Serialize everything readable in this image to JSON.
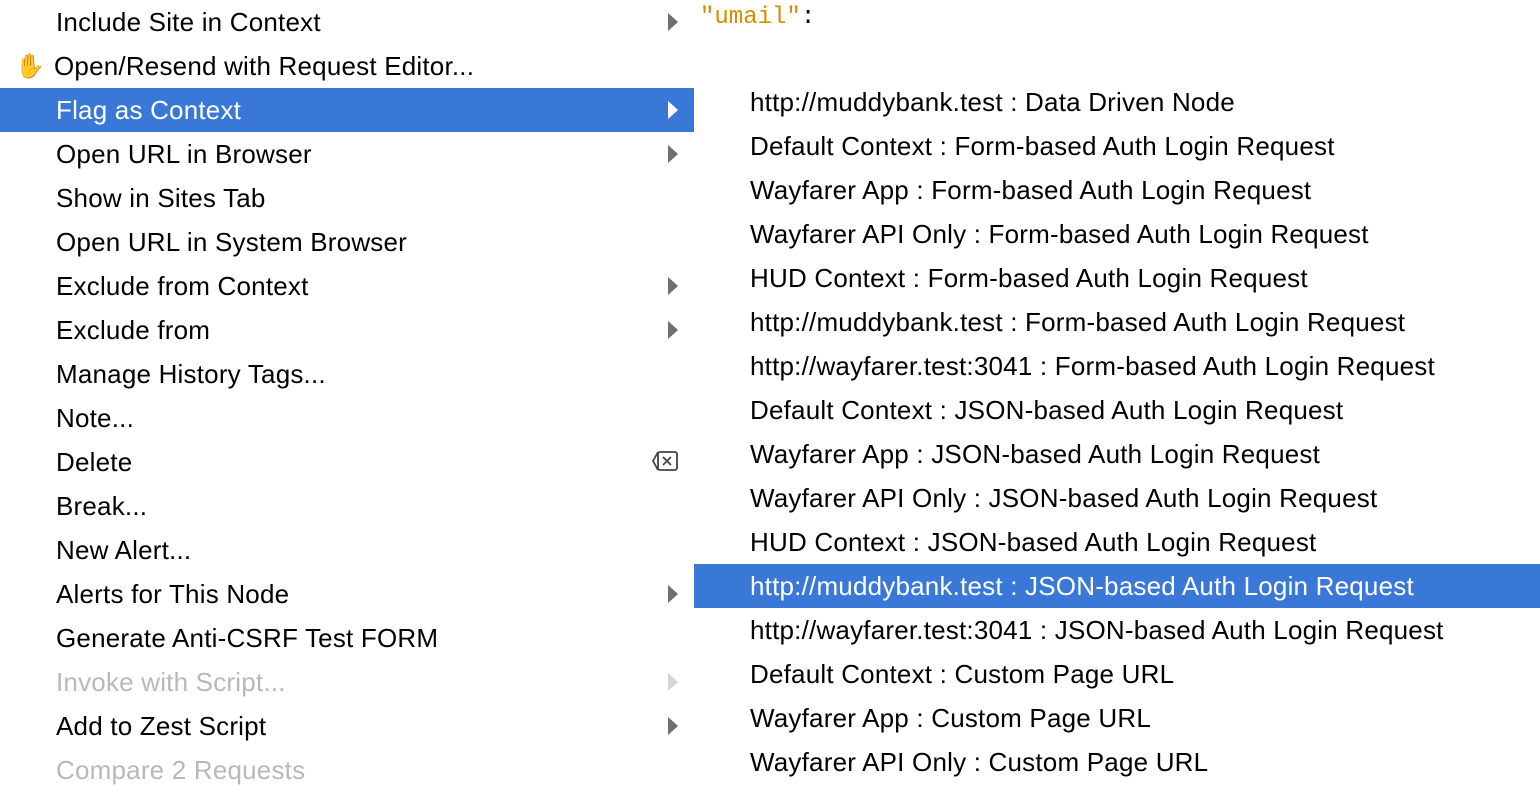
{
  "background": {
    "string": "\"umail\"",
    "after": ":"
  },
  "menu": {
    "items": [
      {
        "label": "Include Site in Context",
        "arrow": true
      },
      {
        "label": "Open/Resend with Request Editor...",
        "icon": "hand-icon"
      },
      {
        "label": "Flag as Context",
        "arrow": true,
        "highlighted": true
      },
      {
        "label": "Open URL in Browser",
        "arrow": true
      },
      {
        "label": "Show in Sites Tab"
      },
      {
        "label": "Open URL in System Browser"
      },
      {
        "label": "Exclude from Context",
        "arrow": true
      },
      {
        "label": "Exclude from",
        "arrow": true
      },
      {
        "label": "Manage History Tags..."
      },
      {
        "label": "Note..."
      },
      {
        "label": "Delete",
        "deleteIcon": true
      },
      {
        "label": "Break..."
      },
      {
        "label": "New Alert..."
      },
      {
        "label": "Alerts for This Node",
        "arrow": true
      },
      {
        "label": "Generate Anti-CSRF Test FORM"
      },
      {
        "label": "Invoke with Script...",
        "arrow": true,
        "disabled": true
      },
      {
        "label": "Add to Zest Script",
        "arrow": true
      },
      {
        "label": "Compare 2 Requests",
        "disabled": true
      }
    ]
  },
  "submenu": {
    "items": [
      {
        "label": "http://muddybank.test : Data Driven Node"
      },
      {
        "label": "Default Context : Form-based Auth Login Request"
      },
      {
        "label": "Wayfarer App : Form-based Auth Login Request"
      },
      {
        "label": "Wayfarer API Only : Form-based Auth Login Request"
      },
      {
        "label": "HUD Context : Form-based Auth Login Request"
      },
      {
        "label": "http://muddybank.test : Form-based Auth Login Request"
      },
      {
        "label": "http://wayfarer.test:3041 : Form-based Auth Login Request"
      },
      {
        "label": "Default Context : JSON-based Auth Login Request"
      },
      {
        "label": "Wayfarer App : JSON-based Auth Login Request"
      },
      {
        "label": "Wayfarer API Only : JSON-based Auth Login Request"
      },
      {
        "label": "HUD Context : JSON-based Auth Login Request"
      },
      {
        "label": "http://muddybank.test : JSON-based Auth Login Request",
        "highlighted": true
      },
      {
        "label": "http://wayfarer.test:3041 : JSON-based Auth Login Request"
      },
      {
        "label": "Default Context : Custom Page URL"
      },
      {
        "label": "Wayfarer App : Custom Page URL"
      },
      {
        "label": "Wayfarer API Only : Custom Page URL"
      }
    ]
  }
}
